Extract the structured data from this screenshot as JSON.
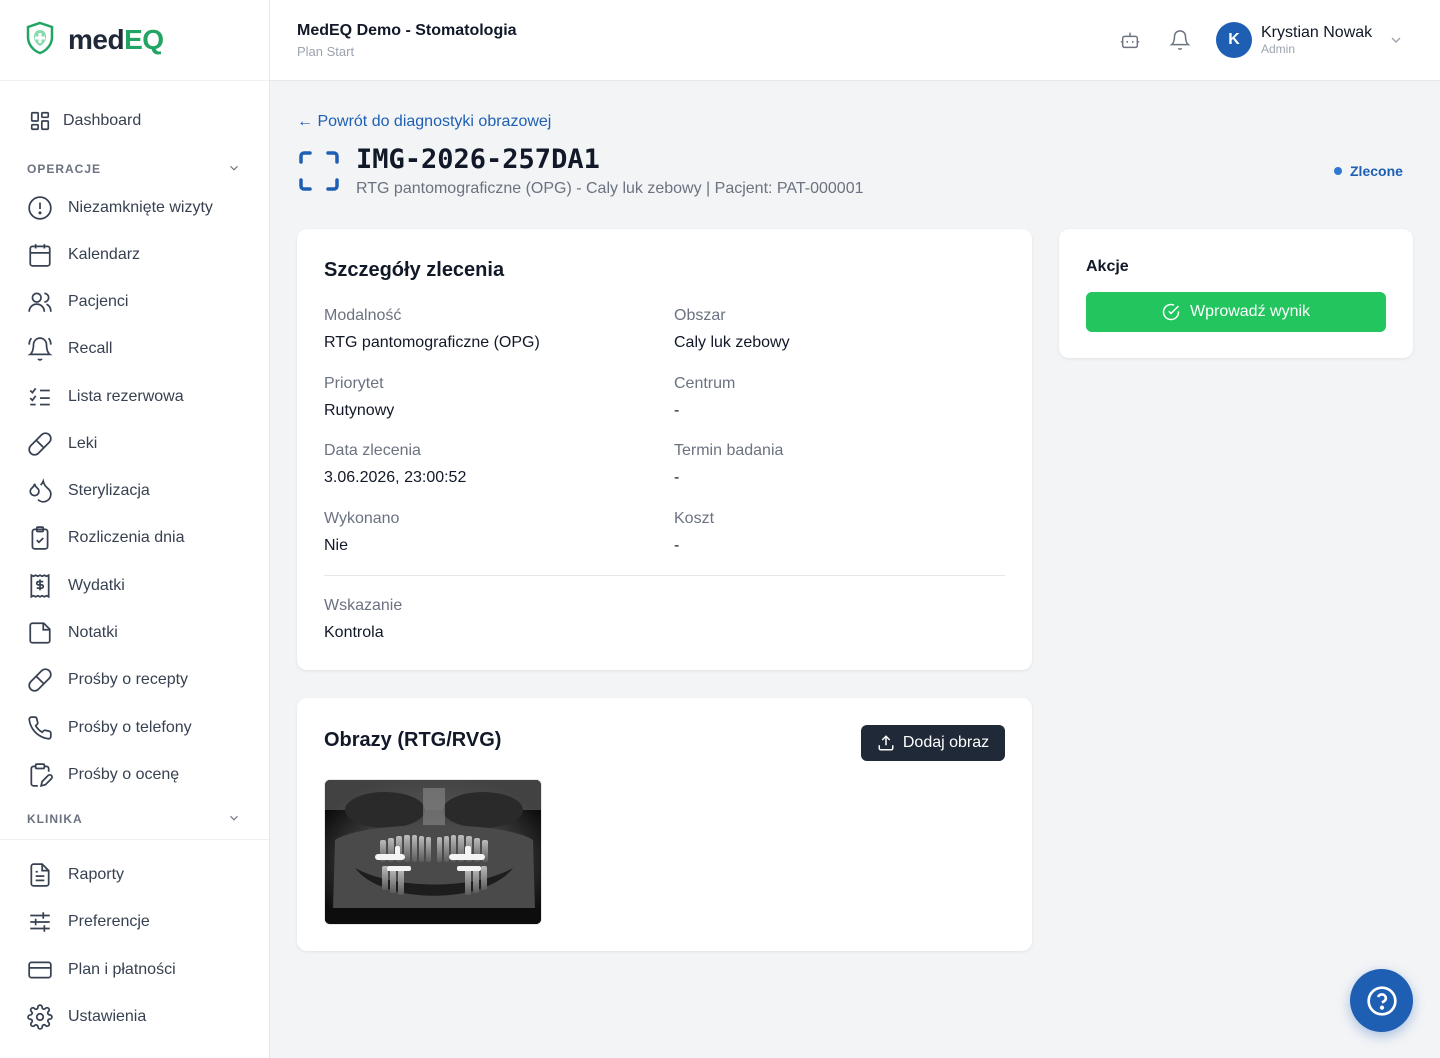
{
  "brand": {
    "name_part1": "med",
    "name_part2": "EQ",
    "accent": "#22a463"
  },
  "topbar": {
    "clinic": "MedEQ Demo - Stomatologia",
    "plan": "Plan Start",
    "icons": [
      "robot-icon",
      "bell-icon"
    ],
    "user": {
      "initial": "K",
      "name": "Krystian Nowak",
      "role": "Admin"
    }
  },
  "sidebar": {
    "dashboard": "Dashboard",
    "section_operations": "OPERACJE",
    "operations": [
      {
        "label": "Niezamknięte wizyty",
        "icon": "alert-circle-icon"
      },
      {
        "label": "Kalendarz",
        "icon": "calendar-icon"
      },
      {
        "label": "Pacjenci",
        "icon": "users-icon"
      },
      {
        "label": "Recall",
        "icon": "bell-ring-icon"
      },
      {
        "label": "Lista rezerwowa",
        "icon": "list-checks-icon"
      },
      {
        "label": "Leki",
        "icon": "pill-icon"
      },
      {
        "label": "Sterylizacja",
        "icon": "droplets-icon"
      },
      {
        "label": "Rozliczenia dnia",
        "icon": "clipboard-check-icon"
      },
      {
        "label": "Wydatki",
        "icon": "receipt-icon"
      },
      {
        "label": "Notatki",
        "icon": "sticky-note-icon"
      },
      {
        "label": "Prośby o recepty",
        "icon": "pill-icon"
      },
      {
        "label": "Prośby o telefony",
        "icon": "phone-icon"
      },
      {
        "label": "Prośby o ocenę",
        "icon": "clipboard-edit-icon"
      }
    ],
    "section_clinic": "KLINIKA",
    "clinic": [
      {
        "label": "Raporty",
        "icon": "file-text-icon"
      },
      {
        "label": "Preferencje",
        "icon": "sliders-icon"
      },
      {
        "label": "Plan i płatności",
        "icon": "credit-card-icon"
      },
      {
        "label": "Ustawienia",
        "icon": "settings-icon"
      }
    ]
  },
  "page": {
    "back_link": "← Powrót do diagnostyki obrazowej",
    "title": "IMG-2026-257DA1",
    "subtitle": "RTG pantomograficzne (OPG) - Caly luk zebowy | Pacjent: PAT-000001",
    "status": "Zlecone",
    "status_color": "#2f78d4"
  },
  "details": {
    "title": "Szczegóły zlecenia",
    "fields": [
      {
        "label": "Modalność",
        "value": "RTG pantomograficzne (OPG)"
      },
      {
        "label": "Obszar",
        "value": "Caly luk zebowy"
      },
      {
        "label": "Priorytet",
        "value": "Rutynowy"
      },
      {
        "label": "Centrum",
        "value": "-"
      },
      {
        "label": "Data zlecenia",
        "value": "3.06.2026, 23:00:52"
      },
      {
        "label": "Termin badania",
        "value": "-"
      },
      {
        "label": "Wykonano",
        "value": "Nie"
      },
      {
        "label": "Koszt",
        "value": "-"
      }
    ],
    "indication_label": "Wskazanie",
    "indication_value": "Kontrola"
  },
  "actions": {
    "title": "Akcje",
    "enter_result": "Wprowadź wynik",
    "button_color": "#22c55e"
  },
  "images": {
    "title": "Obrazy (RTG/RVG)",
    "add_button": "Dodaj obraz"
  }
}
